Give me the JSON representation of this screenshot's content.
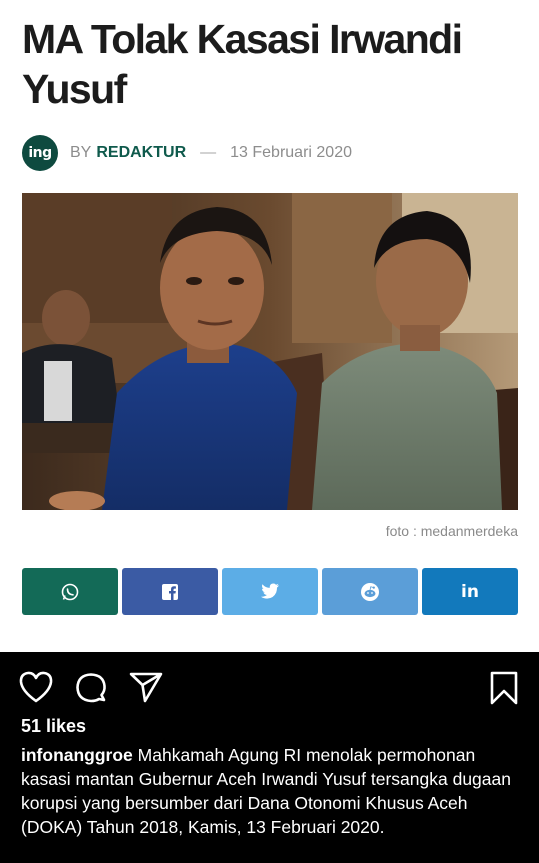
{
  "article": {
    "title": "MA Tolak Kasasi Irwandi Yusuf",
    "logo_text": "ing",
    "by_label": "BY",
    "author": "REDAKTUR",
    "dash": "—",
    "date": "13 Februari 2020",
    "photo_caption": "foto : medanmerdeka"
  },
  "share_buttons": [
    {
      "icon": "whatsapp-icon",
      "color": "#136a57"
    },
    {
      "icon": "facebook-icon",
      "color": "#3b5ba4"
    },
    {
      "icon": "twitter-icon",
      "color": "#5cade6"
    },
    {
      "icon": "reddit-icon",
      "color": "#5b9ed8"
    },
    {
      "icon": "linkedin-icon",
      "label": "in",
      "color": "#1279bc"
    }
  ],
  "instagram": {
    "icons": [
      "heart-icon",
      "comment-icon",
      "share-icon",
      "bookmark-icon"
    ],
    "likes": "51 likes",
    "username": "infonanggroe",
    "caption": "Mahkamah Agung RI menolak permohonan kasasi mantan Gubernur Aceh Irwandi Yusuf tersangka dugaan korupsi yang bersumber dari Dana Otonomi Khusus Aceh (DOKA) Tahun 2018, Kamis, 13 Februari 2020."
  }
}
